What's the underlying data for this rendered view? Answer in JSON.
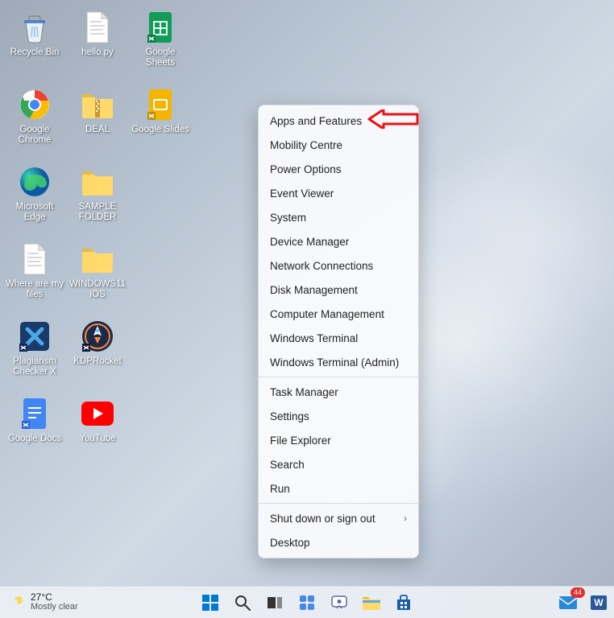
{
  "desktop_icons": [
    {
      "id": "recycle-bin",
      "label": "Recycle Bin"
    },
    {
      "id": "hello-py",
      "label": "hello.py"
    },
    {
      "id": "google-sheets",
      "label": "Google Sheets"
    },
    {
      "id": "google-chrome",
      "label": "Google Chrome"
    },
    {
      "id": "deal",
      "label": "DEAL"
    },
    {
      "id": "google-slides",
      "label": "Google Slides"
    },
    {
      "id": "microsoft-edge",
      "label": "Microsoft Edge"
    },
    {
      "id": "sample-folder",
      "label": "SAMPLE FOLDER"
    },
    {
      "id": "empty-1",
      "label": ""
    },
    {
      "id": "where-are-my-files",
      "label": "Where are my files"
    },
    {
      "id": "windows11-ios",
      "label": "WINDOWS11 IOS"
    },
    {
      "id": "empty-2",
      "label": ""
    },
    {
      "id": "plagiarism-checker-x",
      "label": "Plagiarism Checker X"
    },
    {
      "id": "kdprocket",
      "label": "KDPRocket"
    },
    {
      "id": "empty-3",
      "label": ""
    },
    {
      "id": "google-docs",
      "label": "Google Docs"
    },
    {
      "id": "youtube",
      "label": "YouTube"
    }
  ],
  "context_menu": {
    "groups": [
      [
        "Apps and Features",
        "Mobility Centre",
        "Power Options",
        "Event Viewer",
        "System",
        "Device Manager",
        "Network Connections",
        "Disk Management",
        "Computer Management",
        "Windows Terminal",
        "Windows Terminal (Admin)"
      ],
      [
        "Task Manager",
        "Settings",
        "File Explorer",
        "Search",
        "Run"
      ],
      [
        {
          "label": "Shut down or sign out",
          "submenu": true
        },
        "Desktop"
      ]
    ]
  },
  "taskbar": {
    "weather": {
      "temp": "27°C",
      "condition": "Mostly clear"
    },
    "mail_badge": "44"
  }
}
